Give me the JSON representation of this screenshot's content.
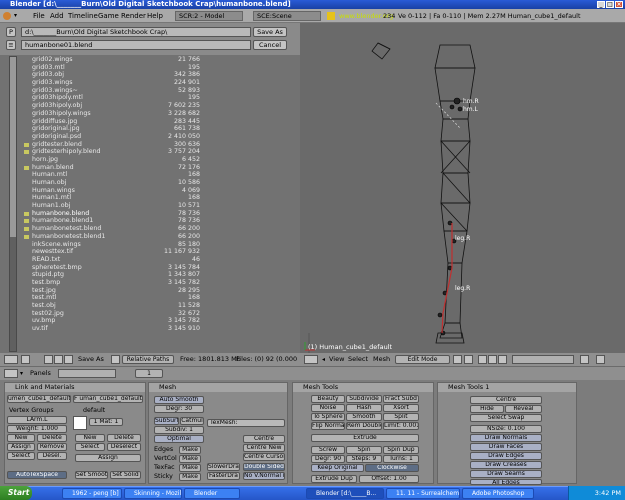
{
  "window": {
    "title": "Blender [d:\\_______Burn\\Old Digital Sketchbook Crap\\humanbone.blend]"
  },
  "menubar": {
    "items": [
      "File",
      "Add",
      "Timeline",
      "Game",
      "Render",
      "Help"
    ],
    "screen_field": "SCR:2 - Model",
    "scene_field": "SCE:Scene",
    "url": "www.blender.org",
    "version": "234",
    "stats": "Ve 0-112 | Fa 0-110 | Mem 2.27M Human_cube1_default"
  },
  "filebrowser": {
    "path": "d:\\_______Burn\\Old Digital Sketchbook Crap\\",
    "filename": "humanbone01.blend",
    "save_as_label": "Save As",
    "cancel_label": "Cancel",
    "files": [
      {
        "name": "grid02.wings",
        "size": "21 766",
        "blend": false,
        "sel": false
      },
      {
        "name": "grid03.mtl",
        "size": "195",
        "blend": false,
        "sel": false
      },
      {
        "name": "grid03.obj",
        "size": "342 386",
        "blend": false,
        "sel": false
      },
      {
        "name": "grid03.wings",
        "size": "224 901",
        "blend": false,
        "sel": false
      },
      {
        "name": "grid03.wings~",
        "size": "52 893",
        "blend": false,
        "sel": false
      },
      {
        "name": "grid03hipoly.mtl",
        "size": "195",
        "blend": false,
        "sel": false
      },
      {
        "name": "grid03hipoly.obj",
        "size": "7 602 235",
        "blend": false,
        "sel": false
      },
      {
        "name": "grid03hipoly.wings",
        "size": "3 228 682",
        "blend": false,
        "sel": false
      },
      {
        "name": "griddiffuse.jpg",
        "size": "283 445",
        "blend": false,
        "sel": false
      },
      {
        "name": "gridoriginal.jpg",
        "size": "661 738",
        "blend": false,
        "sel": false
      },
      {
        "name": "gridoriginal.psd",
        "size": "2 410 050",
        "blend": false,
        "sel": false
      },
      {
        "name": "gridtester.blend",
        "size": "300 636",
        "blend": true,
        "sel": false
      },
      {
        "name": "gridtesterhipoly.blend",
        "size": "3 757 204",
        "blend": true,
        "sel": false
      },
      {
        "name": "horn.jpg",
        "size": "6 452",
        "blend": false,
        "sel": false
      },
      {
        "name": "human.blend",
        "size": "72 176",
        "blend": true,
        "sel": false
      },
      {
        "name": "Human.mtl",
        "size": "168",
        "blend": false,
        "sel": false
      },
      {
        "name": "Human.obj",
        "size": "10 586",
        "blend": false,
        "sel": false
      },
      {
        "name": "Human.wings",
        "size": "4 069",
        "blend": false,
        "sel": false
      },
      {
        "name": "Human1.mtl",
        "size": "168",
        "blend": false,
        "sel": false
      },
      {
        "name": "Human1.obj",
        "size": "10 571",
        "blend": false,
        "sel": false
      },
      {
        "name": "humanbone.blend",
        "size": "78 736",
        "blend": true,
        "sel": false
      },
      {
        "name": "humanbone.blend1",
        "size": "78 736",
        "blend": true,
        "sel": false
      },
      {
        "name": "humanbonetest.blend",
        "size": "66 200",
        "blend": true,
        "sel": false
      },
      {
        "name": "humanbonetest.blend1",
        "size": "66 200",
        "blend": true,
        "sel": false
      },
      {
        "name": "inkScene.wings",
        "size": "85 180",
        "blend": false,
        "sel": false
      },
      {
        "name": "newesttex.tif",
        "size": "11 167 932",
        "blend": false,
        "sel": false
      },
      {
        "name": "READ.txt",
        "size": "46",
        "blend": false,
        "sel": false
      },
      {
        "name": "spheretest.bmp",
        "size": "3 145 784",
        "blend": false,
        "sel": false
      },
      {
        "name": "stupid.ptg",
        "size": "1 343 807",
        "blend": false,
        "sel": false
      },
      {
        "name": "test.bmp",
        "size": "3 145 782",
        "blend": false,
        "sel": false
      },
      {
        "name": "test.jpg",
        "size": "28 295",
        "blend": false,
        "sel": false
      },
      {
        "name": "test.mtl",
        "size": "168",
        "blend": false,
        "sel": false
      },
      {
        "name": "test.obj",
        "size": "11 528",
        "blend": false,
        "sel": false
      },
      {
        "name": "test02.jpg",
        "size": "32 672",
        "blend": false,
        "sel": false
      },
      {
        "name": "uv.bmp",
        "size": "3 145 782",
        "blend": false,
        "sel": false
      },
      {
        "name": "uv.tif",
        "size": "3 145 910",
        "blend": false,
        "sel": false
      }
    ],
    "status": {
      "save_as": "Save As",
      "relative_paths": "Relative Paths",
      "free": "Free: 1801.813 Mb",
      "files": "Files: (0) 92",
      "size": "(0.000"
    }
  },
  "viewport": {
    "object_label": "(1) Human_cube1_default",
    "bone_labels": [
      "hm.R",
      "hm.L",
      "leg.R",
      "leg.R"
    ],
    "header": {
      "view": "View",
      "select": "Select",
      "mesh": "Mesh",
      "mode": "Edit Mode"
    }
  },
  "buttons_header": {
    "panels_label": "Panels",
    "frame": "1"
  },
  "link_materials": {
    "title": "Link and Materials",
    "mesh_name": "umen_cube1_default",
    "object_name": "F uman_cube1_default",
    "vertex_groups_label": "Vertex Groups",
    "group_field": "LArm.L",
    "default_label": "default",
    "weight": "Weight: 1.000",
    "mat_field": "1 Mat: 1",
    "buttons": [
      "New",
      "Delete",
      "Assign",
      "Remove",
      "Select",
      "Desel.",
      "New",
      "Delete",
      "Select",
      "Deselect",
      "Assign"
    ],
    "autotexspace": "AutoTexSpace",
    "set_smooth": "Set Smooth",
    "set_solid": "Set Solid"
  },
  "mesh": {
    "title": "Mesh",
    "auto_smooth": "Auto Smooth",
    "degr": "Degr: 30",
    "subsurf": "SubSurf",
    "catmull": "Catmul",
    "subdiv": "Subdiv: 1",
    "optimal": "Optimal",
    "texmesh": "TexMesh:",
    "edges": "Edges",
    "vertcol": "VertCol",
    "texface": "TexFac",
    "sticky": "Sticky",
    "make": "Make",
    "centre": "Centre",
    "centre_new": "Centre New",
    "centre_cursor": "Centre Cursor",
    "slower_draw": "SlowerDra",
    "faster_draw": "FasterDra",
    "double_sided": "Double Sided",
    "no_v_normal_flip": "No V.Normal Fl"
  },
  "mesh_tools": {
    "title": "Mesh Tools",
    "beauty": "Beauty",
    "subdivide": "Subdivide",
    "fract_subd": "Fract Subd",
    "noise": "Noise",
    "hash": "Hash",
    "xsort": "Xsort",
    "to_sphere": "To Sphere",
    "smooth": "Smooth",
    "split": "Split",
    "flip_normal": "Flip Normal",
    "rem_doubles": "Rem Doubles",
    "limit": "Limit: 0.001",
    "extrude": "Extrude",
    "screw": "Screw",
    "spin": "Spin",
    "spin_dup": "Spin Dup",
    "degr": "Degr: 90",
    "steps": "Steps: 9",
    "turns": "Turns: 1",
    "keep_original": "Keep Original",
    "clockwise": "Clockwise",
    "extrude_dup": "Extrude Dup",
    "offset": "Offset: 1.00"
  },
  "mesh_tools1": {
    "title": "Mesh Tools 1",
    "centre": "Centre",
    "hide": "Hide",
    "reveal": "Reveal",
    "select_swap": "Select Swap",
    "nsize": "NSize: 0.100",
    "draw_normals": "Draw Normals",
    "draw_faces": "Draw Faces",
    "draw_edges": "Draw Edges",
    "draw_creases": "Draw Creases",
    "draw_seams": "Draw Seams",
    "all_edges": "All Edges"
  },
  "taskbar": {
    "start": "Start",
    "tasks": [
      "1962 - peng [b]",
      "Skinning - Mozilla",
      "Blender",
      "Blender [d:\\_____B...",
      "11. 11 - Surrealchemist - ...",
      "Adobe Photoshop"
    ],
    "active_index": 3,
    "clock": "3:42 PM"
  },
  "colors": {
    "accent": "#5d6e8a",
    "selected_text": "#e8c060",
    "viewport_bg": "#6a6a6a",
    "taskbar": "#2556c8"
  }
}
